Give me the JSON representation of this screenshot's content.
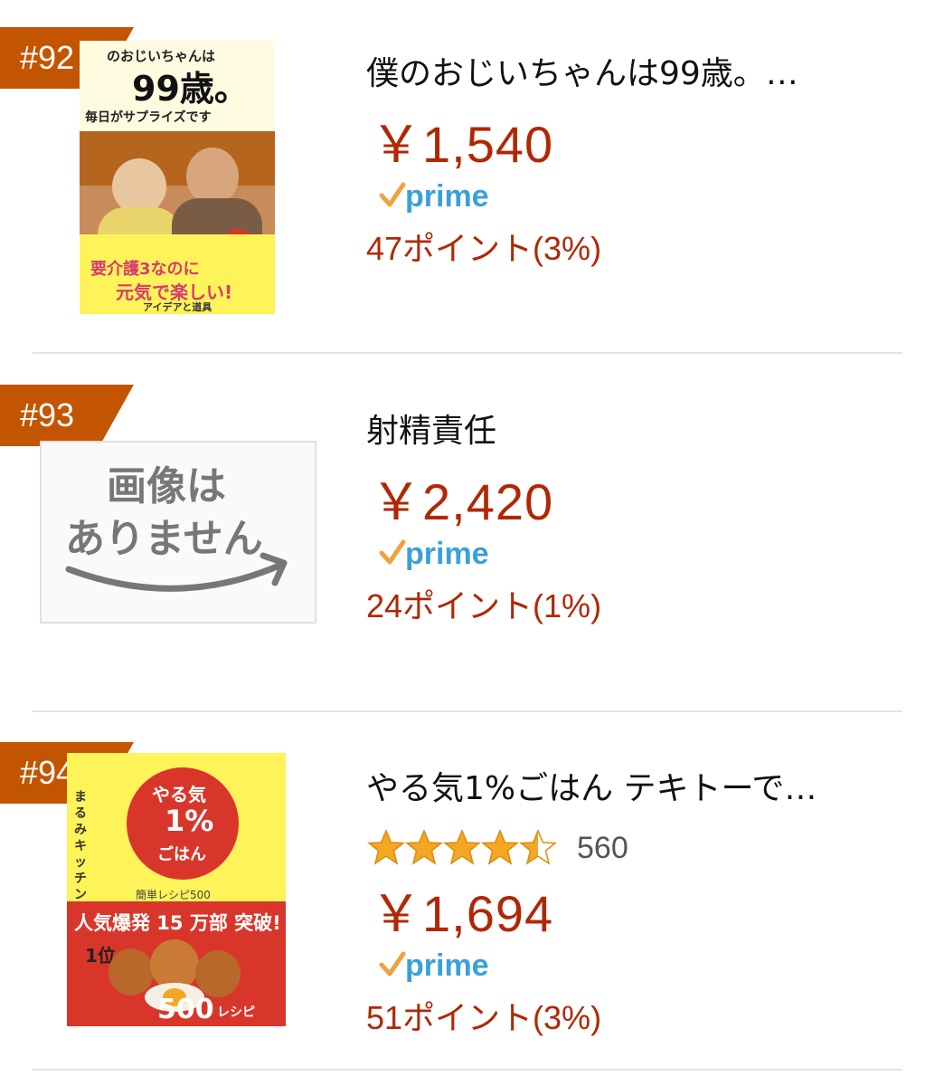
{
  "items": [
    {
      "rank": "#92",
      "title": "僕のおじいちゃんは99歳。…",
      "price": "￥1,540",
      "prime": "prime",
      "points": "47ポイント(3%)",
      "cover": {
        "top": "のおじいちゃんは",
        "big": "99歳。",
        "sub": "毎日がサプライズです",
        "band1": "要介護3なのに",
        "band2": "元気で楽しい!",
        "band3": "アイデアと道具"
      }
    },
    {
      "rank": "#93",
      "title": "射精責任",
      "price": "￥2,420",
      "prime": "prime",
      "points": "24ポイント(1%)",
      "placeholder_line1": "画像は",
      "placeholder_line2": "ありません"
    },
    {
      "rank": "#94",
      "title": "やる気1%ごはん テキトーで…",
      "rating": 4.5,
      "review_count": "560",
      "price": "￥1,694",
      "prime": "prime",
      "points": "51ポイント(3%)",
      "cover": {
        "circle1": "やる気",
        "circle2": "1%",
        "circle3": "ごはん",
        "side": "まるみキッチン",
        "sub": "簡単レシピ500",
        "band": "人気爆発 15 万部 突破!",
        "rank1": "1位",
        "bottom": "500",
        "bottom_suffix": "レシピ"
      }
    }
  ],
  "colors": {
    "price": "#b12704",
    "rank_badge": "#c45500",
    "prime_check": "#f0a23b",
    "prime_text": "#3aa0d8",
    "star": "#f5a623"
  }
}
